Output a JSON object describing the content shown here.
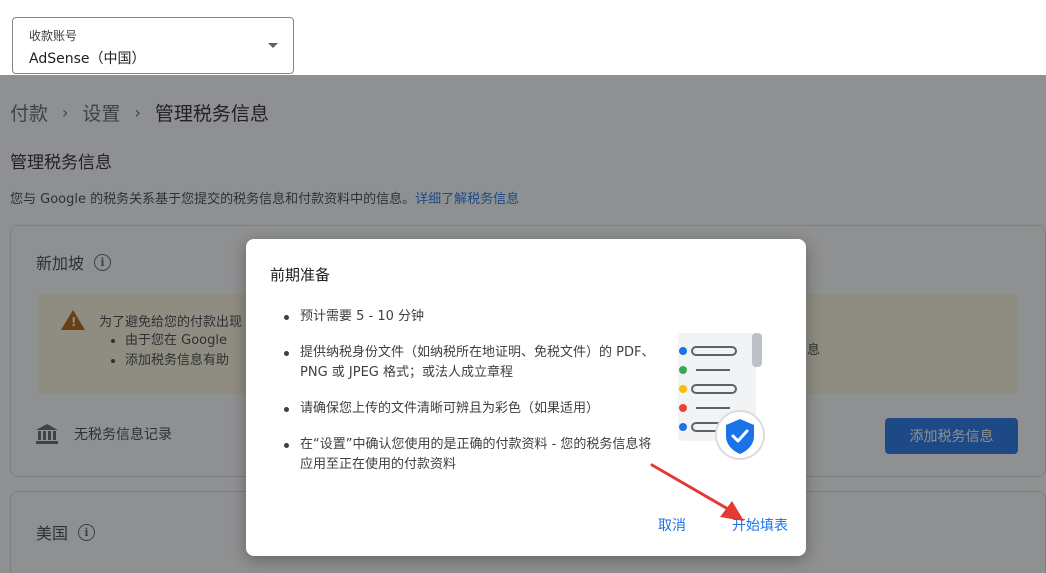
{
  "account": {
    "label": "收款账号",
    "value": "AdSense（中国）"
  },
  "breadcrumb": [
    "付款",
    "设置",
    "管理税务信息"
  ],
  "page": {
    "title": "管理税务信息",
    "desc": "您与 Google 的税务关系基于您提交的税务信息和付款资料中的信息。",
    "desc_link": "详细了解税务信息"
  },
  "card1": {
    "country": "新加坡",
    "warning_title": "为了避免给您的付款出现",
    "warning_items": [
      "由于您在 Google",
      "添加税务信息有助"
    ],
    "warning_tail": "息",
    "no_record": "无税务信息记录",
    "add_button": "添加税务信息"
  },
  "card2": {
    "country": "美国"
  },
  "dialog": {
    "title": "前期准备",
    "steps": [
      "预计需要 5 - 10 分钟",
      "提供纳税身份文件（如纳税所在地证明、免税文件）的 PDF、PNG 或 JPEG 格式；或法人成立章程",
      "请确保您上传的文件清晰可辨且为彩色（如果适用）",
      "在“设置”中确认您使用的是正确的付款资料 - 您的税务信息将应用至正在使用的付款资料"
    ],
    "cancel": "取消",
    "start": "开始填表"
  },
  "colors": {
    "accent": "#1a73e8",
    "warning_bg": "#fef7e0",
    "arrow": "#e53935"
  },
  "icons": [
    "chevron-down-icon",
    "info-icon",
    "warning-icon",
    "bank-icon",
    "document-shield-icon"
  ]
}
